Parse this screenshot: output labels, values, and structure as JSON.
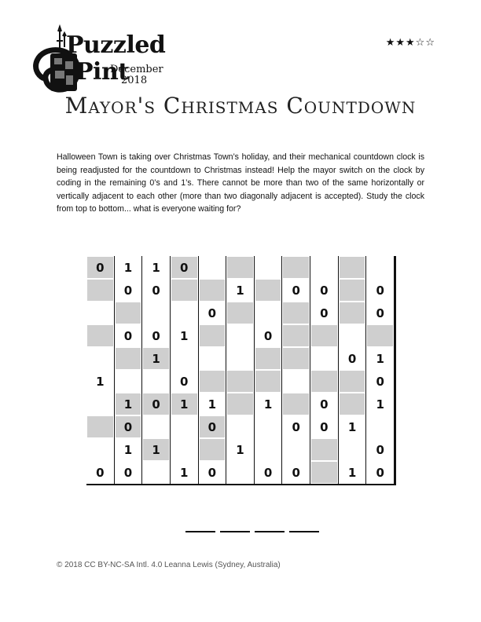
{
  "header": {
    "logo_line1": "Puzzled",
    "logo_line2": "Pint",
    "logo_month": "December",
    "logo_year": "2018",
    "difficulty_stars": "★★★☆☆",
    "title": "Mayor's Christmas Countdown"
  },
  "intro": "Halloween Town is taking over Christmas Town’s holiday, and their mechanical countdown clock is being readjusted for the countdown to Christmas instead! Help the mayor switch on the clock by coding in the remaining 0’s and 1’s. There cannot be more than two of the same horizontally or vertically adjacent to each other (more than two diagonally adjacent is accepted). Study the clock from top to bottom... what is everyone waiting for?",
  "grid": {
    "rows": [
      [
        "0",
        "1",
        "1",
        "0",
        "",
        "",
        "",
        "",
        "",
        "",
        ""
      ],
      [
        "",
        "0",
        "0",
        "",
        "",
        "1",
        "",
        "0",
        "0",
        "",
        "0"
      ],
      [
        "",
        "",
        "",
        "",
        "0",
        "",
        "",
        "",
        "0",
        "",
        "0"
      ],
      [
        "",
        "0",
        "0",
        "1",
        "",
        "",
        "0",
        "",
        "",
        "",
        ""
      ],
      [
        "",
        "",
        "1",
        "",
        "",
        "",
        "",
        "",
        "",
        "0",
        "1"
      ],
      [
        "1",
        "",
        "",
        "0",
        "",
        "",
        "",
        "",
        "",
        "",
        "0"
      ],
      [
        "",
        "1",
        "0",
        "1",
        "1",
        "",
        "1",
        "",
        "0",
        "",
        "1"
      ],
      [
        "",
        "0",
        "",
        "",
        "0",
        "",
        "",
        "0",
        "0",
        "1",
        ""
      ],
      [
        "",
        "1",
        "1",
        "",
        "",
        "1",
        "",
        "",
        "",
        "",
        "0"
      ],
      [
        "0",
        "0",
        "",
        "1",
        "0",
        "",
        "0",
        "0",
        "",
        "1",
        "0"
      ]
    ],
    "shaded": [
      [
        1,
        0,
        0,
        1,
        0,
        1,
        0,
        1,
        0,
        1,
        0
      ],
      [
        1,
        0,
        0,
        1,
        1,
        0,
        1,
        0,
        0,
        1,
        0
      ],
      [
        0,
        1,
        0,
        0,
        0,
        1,
        0,
        1,
        0,
        1,
        0
      ],
      [
        1,
        0,
        0,
        0,
        1,
        0,
        0,
        1,
        1,
        0,
        1
      ],
      [
        0,
        1,
        1,
        0,
        0,
        0,
        1,
        1,
        0,
        0,
        0
      ],
      [
        0,
        0,
        0,
        0,
        1,
        1,
        1,
        0,
        1,
        1,
        0
      ],
      [
        0,
        1,
        1,
        1,
        0,
        1,
        0,
        1,
        0,
        1,
        0
      ],
      [
        1,
        1,
        0,
        0,
        1,
        0,
        0,
        0,
        0,
        0,
        0
      ],
      [
        0,
        0,
        1,
        0,
        1,
        0,
        0,
        0,
        1,
        0,
        0
      ],
      [
        0,
        0,
        0,
        0,
        0,
        0,
        0,
        0,
        1,
        0,
        0
      ]
    ]
  },
  "answer_blanks": 4,
  "footer": "© 2018 CC BY-NC-SA Intl. 4.0 Leanna Lewis (Sydney, Australia)"
}
